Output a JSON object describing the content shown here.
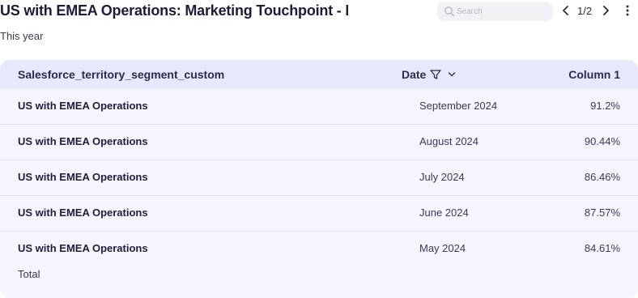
{
  "header": {
    "title": "US with EMEA Operations: Marketing Touchpoint - Er",
    "subtitle": "This year",
    "search_placeholder": "Search",
    "pager": "1/2"
  },
  "table": {
    "columns": {
      "segment": "Salesforce_territory_segment_custom",
      "date": "Date",
      "column1": "Column 1"
    },
    "rows": [
      {
        "segment": "US with EMEA Operations",
        "date": "September 2024",
        "value": "91.2%"
      },
      {
        "segment": "US with EMEA Operations",
        "date": "August 2024",
        "value": "90.44%"
      },
      {
        "segment": "US with EMEA Operations",
        "date": "July 2024",
        "value": "86.46%"
      },
      {
        "segment": "US with EMEA Operations",
        "date": "June 2024",
        "value": "87.57%"
      },
      {
        "segment": "US with EMEA Operations",
        "date": "May 2024",
        "value": "84.61%"
      }
    ],
    "total_label": "Total"
  },
  "icons": {
    "search": "search-icon",
    "prev": "chevron-left-icon",
    "next": "chevron-right-icon",
    "more": "more-vertical-icon",
    "filter": "filter-icon",
    "sort": "chevron-down-icon"
  },
  "colors": {
    "table_bg": "#f4f5fe",
    "header_bg": "#e6e8fb",
    "text": "#1e1e3a"
  }
}
